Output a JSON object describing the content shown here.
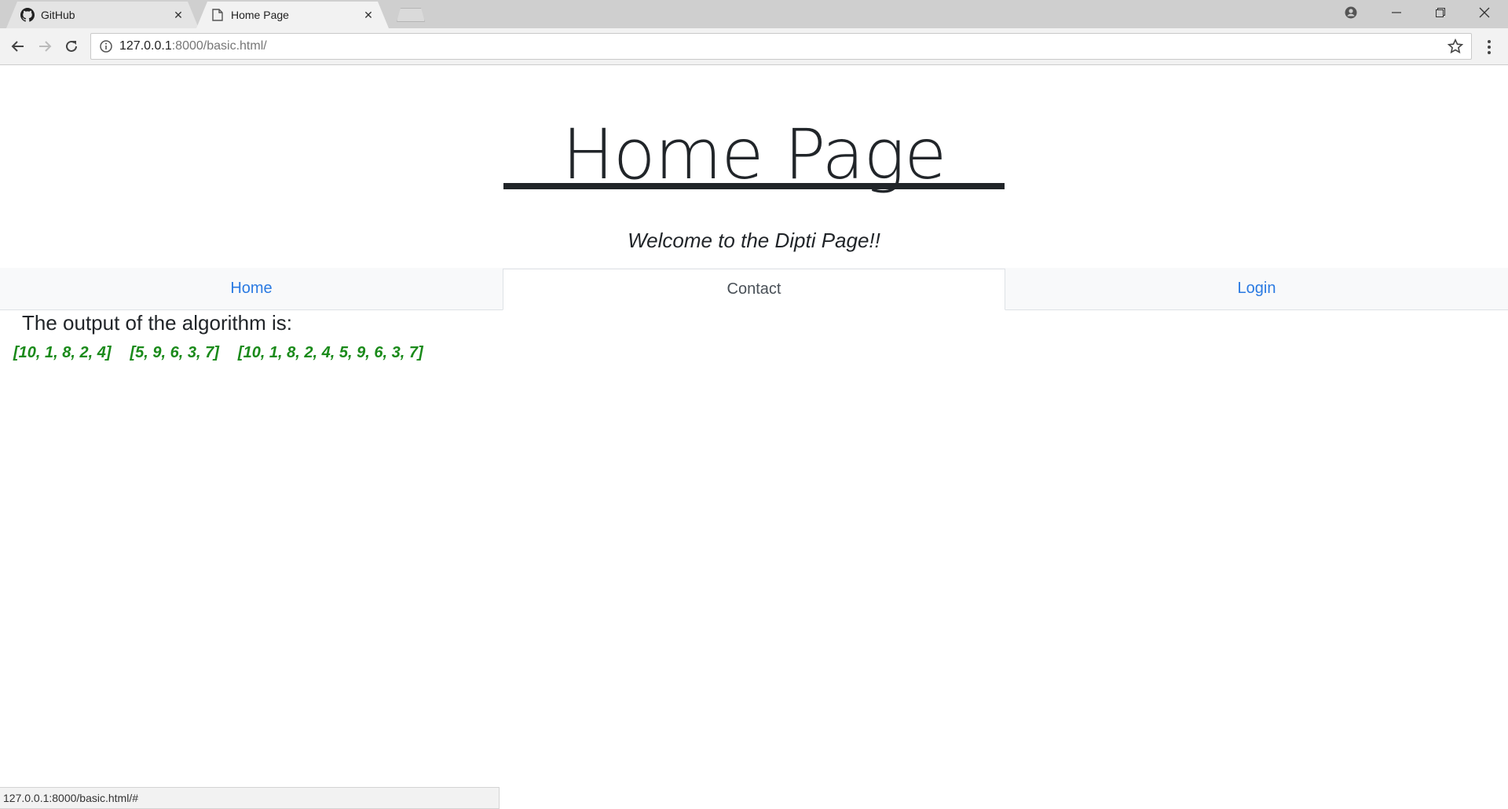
{
  "browser": {
    "tabs": [
      {
        "title": "GitHub",
        "icon": "github-icon",
        "active": false
      },
      {
        "title": "Home Page",
        "icon": "page-icon",
        "active": true
      }
    ],
    "url_host": "127.0.0.1",
    "url_rest": ":8000/basic.html/",
    "status_url": "127.0.0.1:8000/basic.html/#"
  },
  "page": {
    "title": "Home Page",
    "subtitle": "Welcome to the Dipti Page!!",
    "nav": [
      {
        "label": "Home",
        "active": false
      },
      {
        "label": "Contact",
        "active": true
      },
      {
        "label": "Login",
        "active": false
      }
    ],
    "output_heading": "The output of the algorithm is:",
    "results": [
      "[10, 1, 8, 2, 4]",
      "[5, 9, 6, 3, 7]",
      "[10, 1, 8, 2, 4, 5, 9, 6, 3, 7]"
    ]
  },
  "colors": {
    "link": "#2a7ae2",
    "result_green": "#1a8a1a",
    "text": "#212529"
  }
}
